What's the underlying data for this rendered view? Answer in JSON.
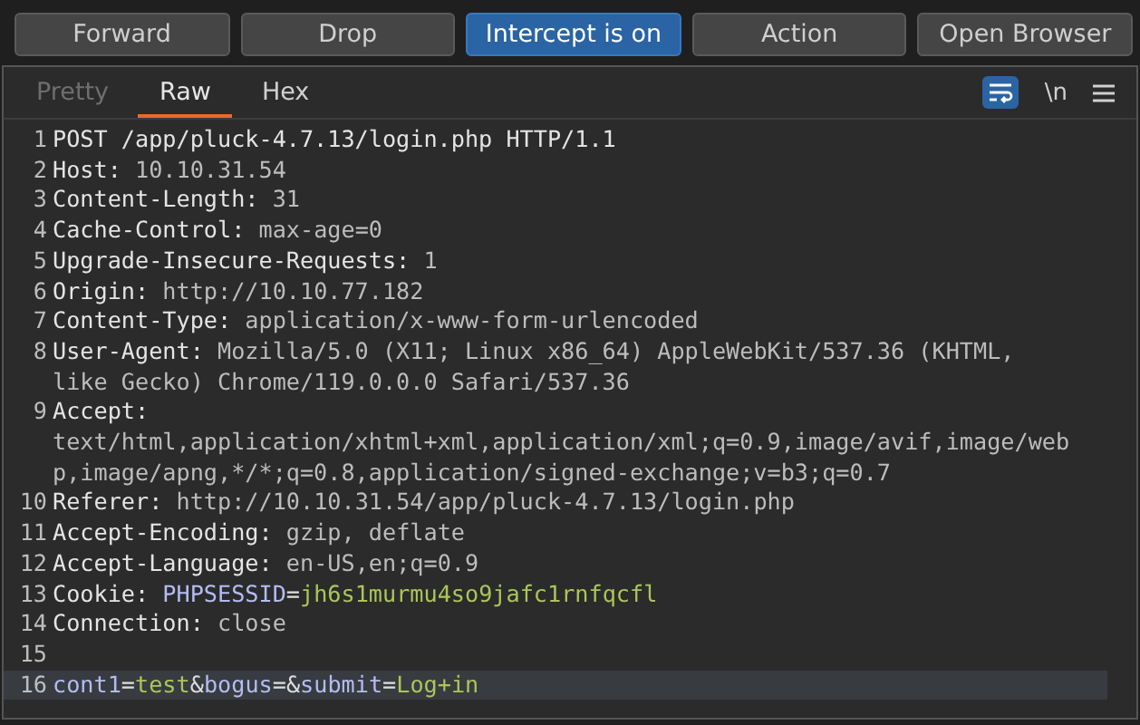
{
  "toolbar": {
    "buttons": [
      {
        "label": "Forward",
        "active": false
      },
      {
        "label": "Drop",
        "active": false
      },
      {
        "label": "Intercept is on",
        "active": true
      },
      {
        "label": "Action",
        "active": false
      },
      {
        "label": "Open Browser",
        "active": false
      }
    ]
  },
  "editor_tabs": [
    {
      "label": "Pretty",
      "selected": false,
      "disabled": true
    },
    {
      "label": "Raw",
      "selected": true,
      "disabled": false
    },
    {
      "label": "Hex",
      "selected": false,
      "disabled": false
    }
  ],
  "editor_tools": {
    "wrap_on": true,
    "newline_toggle": "\\n"
  },
  "lines": [
    {
      "number": "1",
      "highlighted": false,
      "segments": [
        {
          "kind": "name",
          "text": "POST /app/pluck-4.7.13/login.php HTTP/1.1"
        }
      ]
    },
    {
      "number": "2",
      "highlighted": false,
      "segments": [
        {
          "kind": "name",
          "text": "Host:"
        },
        {
          "kind": "value",
          "text": " 10.10.31.54"
        }
      ]
    },
    {
      "number": "3",
      "highlighted": false,
      "segments": [
        {
          "kind": "name",
          "text": "Content-Length:"
        },
        {
          "kind": "value",
          "text": " 31"
        }
      ]
    },
    {
      "number": "4",
      "highlighted": false,
      "segments": [
        {
          "kind": "name",
          "text": "Cache-Control:"
        },
        {
          "kind": "value",
          "text": " max-age=0"
        }
      ]
    },
    {
      "number": "5",
      "highlighted": false,
      "segments": [
        {
          "kind": "name",
          "text": "Upgrade-Insecure-Requests:"
        },
        {
          "kind": "value",
          "text": " 1"
        }
      ]
    },
    {
      "number": "6",
      "highlighted": false,
      "segments": [
        {
          "kind": "name",
          "text": "Origin:"
        },
        {
          "kind": "value",
          "text": " http://10.10.77.182"
        }
      ]
    },
    {
      "number": "7",
      "highlighted": false,
      "segments": [
        {
          "kind": "name",
          "text": "Content-Type:"
        },
        {
          "kind": "value",
          "text": " application/x-www-form-urlencoded"
        }
      ]
    },
    {
      "number": "8",
      "highlighted": false,
      "segments": [
        {
          "kind": "name",
          "text": "User-Agent:"
        },
        {
          "kind": "value",
          "text": " Mozilla/5.0 (X11; Linux x86_64) AppleWebKit/537.36 (KHTML, like Gecko) Chrome/119.0.0.0 Safari/537.36"
        }
      ]
    },
    {
      "number": "9",
      "highlighted": false,
      "segments": [
        {
          "kind": "name",
          "text": "Accept:"
        },
        {
          "kind": "value",
          "text": " text/html,application/xhtml+xml,application/xml;q=0.9,image/avif,image/webp,image/apng,*/*;q=0.8,application/signed-exchange;v=b3;q=0.7"
        }
      ]
    },
    {
      "number": "10",
      "highlighted": false,
      "segments": [
        {
          "kind": "name",
          "text": "Referer:"
        },
        {
          "kind": "value",
          "text": " http://10.10.31.54/app/pluck-4.7.13/login.php"
        }
      ]
    },
    {
      "number": "11",
      "highlighted": false,
      "segments": [
        {
          "kind": "name",
          "text": "Accept-Encoding:"
        },
        {
          "kind": "value",
          "text": " gzip, deflate"
        }
      ]
    },
    {
      "number": "12",
      "highlighted": false,
      "segments": [
        {
          "kind": "name",
          "text": "Accept-Language:"
        },
        {
          "kind": "value",
          "text": " en-US,en;q=0.9"
        }
      ]
    },
    {
      "number": "13",
      "highlighted": false,
      "segments": [
        {
          "kind": "name",
          "text": "Cookie: "
        },
        {
          "kind": "param",
          "text": "PHPSESSID"
        },
        {
          "kind": "punct",
          "text": "="
        },
        {
          "kind": "param_value",
          "text": "jh6s1murmu4so9jafc1rnfqcfl"
        }
      ]
    },
    {
      "number": "14",
      "highlighted": false,
      "segments": [
        {
          "kind": "name",
          "text": "Connection:"
        },
        {
          "kind": "value",
          "text": " close"
        }
      ]
    },
    {
      "number": "15",
      "highlighted": false
    },
    {
      "number": "16",
      "highlighted": true,
      "segments": [
        {
          "kind": "param",
          "text": "cont1"
        },
        {
          "kind": "punct",
          "text": "="
        },
        {
          "kind": "param_value",
          "text": "test"
        },
        {
          "kind": "punct",
          "text": "&"
        },
        {
          "kind": "param",
          "text": "bogus"
        },
        {
          "kind": "punct",
          "text": "=&"
        },
        {
          "kind": "param",
          "text": "submit"
        },
        {
          "kind": "punct",
          "text": "="
        },
        {
          "kind": "param_value",
          "text": "Log+in"
        }
      ]
    }
  ]
}
